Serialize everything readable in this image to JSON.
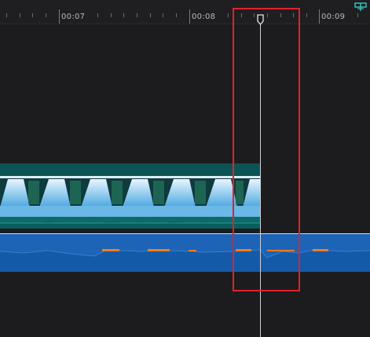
{
  "ruler": {
    "labels": [
      "00:07",
      "00:08",
      "00:09"
    ]
  },
  "colors": {
    "background": "#1c1c1e",
    "video_clip": "#0c5353",
    "audio_track": "#1d63b6",
    "playhead": "#cfd2d6",
    "highlight": "#e0222a",
    "snap_icon": "#33c7c4"
  },
  "icons": {
    "snap": "snap-icon",
    "playhead_handle": "playhead-handle-icon"
  }
}
